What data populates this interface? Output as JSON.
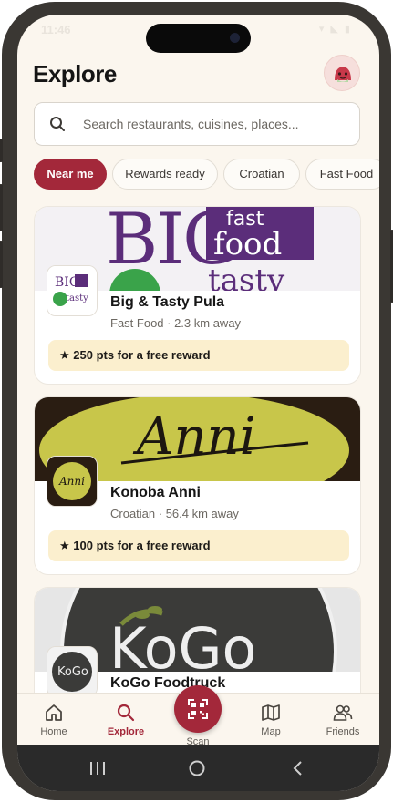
{
  "status": {
    "time": "11:46",
    "icons": "▾ ◣ ▮"
  },
  "header": {
    "title": "Explore"
  },
  "search": {
    "placeholder": "Search restaurants, cuisines, places..."
  },
  "chips": [
    "Near me",
    "Rewards ready",
    "Croatian",
    "Fast Food"
  ],
  "restaurants": [
    {
      "name": "Big & Tasty Pula",
      "meta": "Fast Food · 2.3 km away",
      "reward": "★ 250 pts for a free reward",
      "logo_text": "BIG FAST FOOD & TASTY",
      "banner_text": "BIG fast food tasty"
    },
    {
      "name": "Konoba Anni",
      "meta": "Croatian · 56.4 km away",
      "reward": "★ 100 pts for a free reward",
      "logo_text": "Anni",
      "banner_text": "Anni"
    },
    {
      "name": "KoGo Foodtruck",
      "logo_text": "KoGo",
      "banner_text": "KoGo"
    }
  ],
  "nav": {
    "home": "Home",
    "explore": "Explore",
    "scan": "Scan",
    "map": "Map",
    "friends": "Friends"
  },
  "colors": {
    "accent": "#a3283a",
    "background": "#fbf6ee",
    "reward_bg": "#fbefce"
  }
}
